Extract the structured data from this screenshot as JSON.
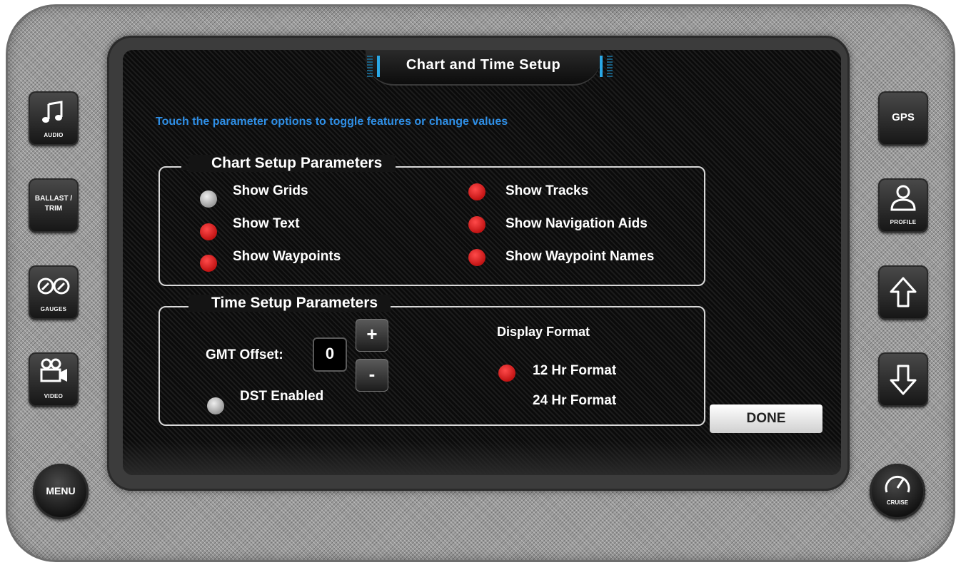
{
  "screen": {
    "title": "Chart and Time Setup",
    "hint": "Touch the parameter options to toggle features or change values"
  },
  "chart_setup": {
    "title": "Chart Setup Parameters",
    "options": [
      {
        "label": "Show Grids",
        "enabled": false
      },
      {
        "label": "Show Text",
        "enabled": true
      },
      {
        "label": "Show Waypoints",
        "enabled": true
      },
      {
        "label": "Show Tracks",
        "enabled": true
      },
      {
        "label": "Show Navigation Aids",
        "enabled": true
      },
      {
        "label": "Show Waypoint Names",
        "enabled": true
      }
    ]
  },
  "time_setup": {
    "title": "Time Setup Parameters",
    "gmt_label": "GMT Offset:",
    "gmt_value": "0",
    "plus": "+",
    "minus": "-",
    "dst_label": "DST Enabled",
    "dst_enabled": false,
    "display_format_label": "Display Format",
    "format_12": "12 Hr Format",
    "format_24": "24 Hr Format",
    "selected_format": "12 Hr Format"
  },
  "done_label": "DONE",
  "left_buttons": [
    {
      "icon": "music-note-icon",
      "caption": "AUDIO"
    },
    {
      "text": "BALLAST / TRIM"
    },
    {
      "icon": "gauges-icon",
      "caption": "GAUGES"
    },
    {
      "icon": "video-camera-icon",
      "caption": "VIDEO"
    }
  ],
  "menu_label": "MENU",
  "right_buttons": [
    {
      "text": "GPS"
    },
    {
      "icon": "profile-icon",
      "caption": "PROFILE"
    },
    {
      "icon": "arrow-up-icon"
    },
    {
      "icon": "arrow-down-icon"
    }
  ],
  "cruise_label": "CRUISE",
  "colors": {
    "hint_blue": "#2f8fe6",
    "title_accent": "#2aa8e6",
    "dot_on": "#d91a1a",
    "dot_off": "#bdbdbd"
  }
}
